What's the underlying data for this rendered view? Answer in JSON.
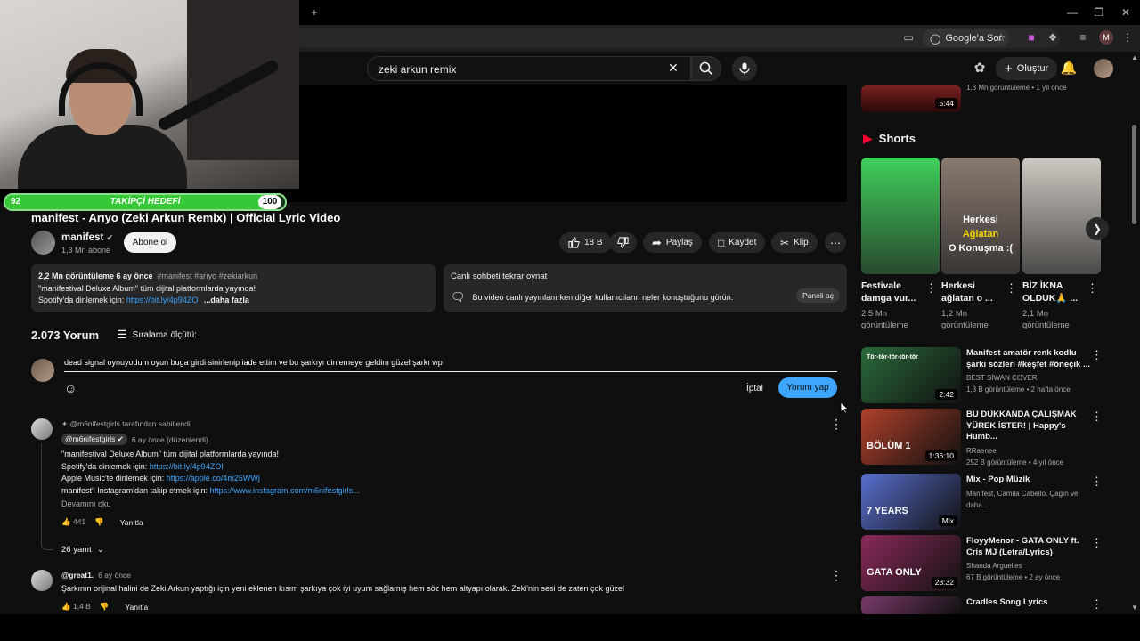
{
  "browser": {
    "new_tab": "+",
    "google_sor": "Google'a Sor",
    "profile_letter": "M"
  },
  "header": {
    "search_value": "zeki arkun remix",
    "create_label": "Oluştur"
  },
  "stream": {
    "goal_current": "92",
    "goal_title": "TAKİPÇİ HEDEFİ",
    "goal_target": "100",
    "goal_fraction": 0.92
  },
  "video": {
    "title": "manifest - Arıyo (Zeki Arkun Remix) | Official Lyric Video",
    "channel": "manifest",
    "subscribers": "1,3 Mn abone",
    "subscribe_label": "Abone ol",
    "likes": "18 B",
    "share": "Paylaş",
    "save": "Kaydet",
    "clip": "Klip"
  },
  "description": {
    "stats": "2,2 Mn görüntüleme  6 ay önce",
    "tags": "#manifest #arıyo #zekiarkun",
    "line1": "\"manifestival Deluxe Album\" tüm dijital platformlarda yayında!",
    "line2_prefix": "Spotify'da dinlemek için: ",
    "line2_link": "https://bit.ly/4p94ZO",
    "more": "...daha fazla"
  },
  "replay": {
    "title": "Canlı sohbeti tekrar oynat",
    "text": "Bu video canlı yayınlanırken diğer kullanıcıların neler konuştuğunu görün.",
    "button": "Paneli aç"
  },
  "comments": {
    "count": "2.073 Yorum",
    "sort_label": "Sıralama ölçütü:",
    "draft": "dead signal oynuyodum oyun buga girdi sinirlenip iade ettim ve bu şarkıyı dinlemeye geldim güzel şarkı wp",
    "cancel": "İptal",
    "post": "Yorum yap",
    "pinned": {
      "pinned_by": "@m6nifestgirls tarafından sabitlendi",
      "author": "@m6nifestgirls",
      "time": "6 ay önce (düzenlendi)",
      "line1": "\"manifestival Deluxe Album\" tüm dijital platformlarda yayında!",
      "line2_prefix": "Spotify'da dinlemek için: ",
      "line2_link": "https://bit.ly/4p94ZOI",
      "line3_prefix": "Apple Music'te dinlemek için: ",
      "line3_link": "https://apple.co/4m25WWj",
      "line4_prefix": "manifest'i Instagram'dan takip etmek için: ",
      "line4_link": "https://www.instagram.com/m6nifestgirls...",
      "read_more": "Devamını oku",
      "likes": "441",
      "reply": "Yanıtla",
      "replies": "26 yanıt"
    },
    "second": {
      "author": "@great1.",
      "time": "6 ay önce",
      "text": "Şarkının orijinal halini de Zeki Arkun yaptığı için yeni eklenen kısım şarkıya çok iyi uyum sağlamış hem söz hem altyapı olarak. Zeki'nin sesi de zaten çok güzel",
      "likes": "1,4 B",
      "reply": "Yanıtla"
    }
  },
  "sidebar": {
    "top_item": {
      "meta": "1,3 Mn görüntüleme • 1 yıl önce",
      "duration": "5:44"
    },
    "shorts_title": "Shorts",
    "shorts": [
      {
        "title1": "Festivale",
        "title2": "damga vur...",
        "meta1": "2,5 Mn",
        "meta2": "görüntüleme",
        "color": "#3fcf5a"
      },
      {
        "title1": "Herkesi",
        "title2": "ağlatan o ...",
        "meta1": "1,2 Mn",
        "meta2": "görüntüleme",
        "overlay1": "Herkesi",
        "overlay2": "Ağlatan",
        "overlay3": "O Konuşma :(",
        "color": "#8a7a70"
      },
      {
        "title1": "BİZ İKNA",
        "title2": "OLDUK🙏 ...",
        "meta1": "2,1 Mn",
        "meta2": "görüntüleme",
        "color": "#cfc9c2"
      }
    ],
    "videos": [
      {
        "title1": "Manifest amatör renk kodlu",
        "title2": "şarkı sözleri #keşfet #öneçık ...",
        "channel": "BEST SİWAN COVER",
        "meta": "1,3 B görüntüleme • 2 hafta önce",
        "duration": "2:42",
        "color": "#2a6a3a",
        "thumb_text": "Tör-tör-tör-tör-tör"
      },
      {
        "title1": "BU DÜKKANDA ÇALIŞMAK",
        "title2": "YÜREK İSTER! | Happy's Humb...",
        "channel": "RRaenee",
        "meta": "252 B görüntüleme • 4 yıl önce",
        "duration": "1:36:10",
        "color": "#b0402a",
        "thumb_text": "BÖLÜM 1"
      },
      {
        "title1": "Mix - Pop Müzik",
        "title2": "",
        "channel": "Manifest, Camila Cabello, Çağın ve daha...",
        "meta": "",
        "duration": "Mix",
        "color": "#5a6fd0",
        "thumb_text": "7 YEARS"
      },
      {
        "title1": "FloyyMenor - GATA ONLY ft.",
        "title2": "Cris MJ (Letra/Lyrics)",
        "channel": "Shanda Arguelles",
        "meta": "67 B görüntüleme • 2 ay önce",
        "duration": "23:32",
        "color": "#8a2a5a",
        "thumb_text": "GATA ONLY"
      },
      {
        "title1": "Cradles Song Lyrics",
        "title2": "",
        "channel": "",
        "meta": "",
        "duration": "",
        "color": "#7a3a6a",
        "thumb_text": ""
      }
    ]
  }
}
